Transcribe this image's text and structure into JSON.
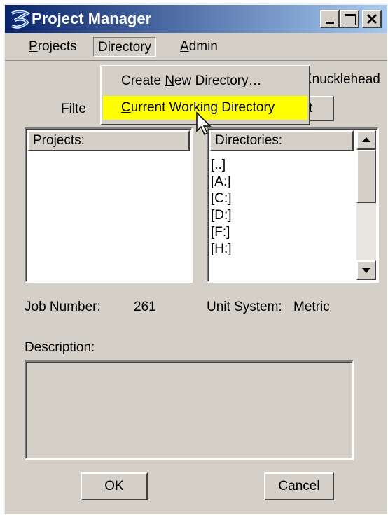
{
  "window": {
    "title": "Project Manager",
    "controls": [
      "_",
      "□",
      "×"
    ]
  },
  "menubar": {
    "projects": "Projects",
    "directory": "Directory",
    "admin": "Admin"
  },
  "directory_menu": {
    "items": [
      {
        "label_pre": "Create ",
        "label_u": "N",
        "label_post": "ew Directory…"
      },
      {
        "label_pre": "",
        "label_u": "C",
        "label_post": "urrent Working Directory",
        "highlighted": true
      }
    ]
  },
  "background": {
    "user_text": "Knucklehead",
    "filter_label": "Filte",
    "filter_button_suffix": "t"
  },
  "projects_list": {
    "header": "Projects:",
    "items": []
  },
  "directories_list": {
    "header": "Directories:",
    "items": [
      "[..]",
      "[A:]",
      "[C:]",
      "[D:]",
      "[F:]",
      "[H:]"
    ]
  },
  "job": {
    "label": "Job Number:",
    "value": "261"
  },
  "unit_system": {
    "label": "Unit System:",
    "value": "Metric"
  },
  "description": {
    "label": "Description:",
    "value": ""
  },
  "buttons": {
    "ok": "OK",
    "ok_underline": "O",
    "ok_rest": "K",
    "cancel": "Cancel"
  },
  "colors": {
    "titlebar_start": "#0a246a",
    "titlebar_end": "#a6caf0",
    "face": "#d4d0c8",
    "highlight": "#ffff00"
  }
}
